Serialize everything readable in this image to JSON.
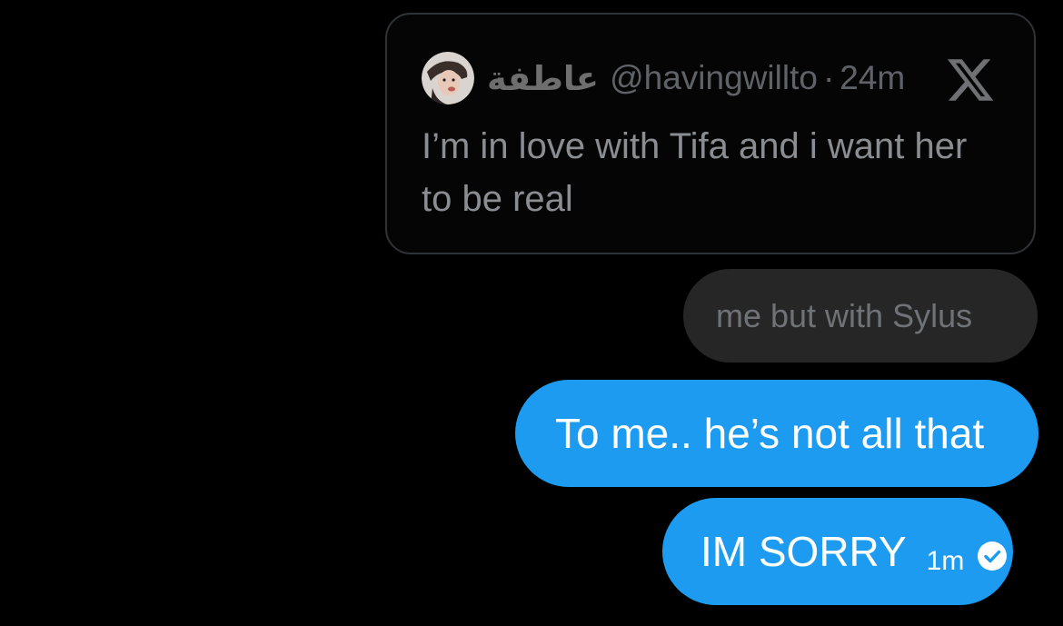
{
  "quoted_post": {
    "author_name": "عاطفة",
    "handle": "@havingwillto",
    "separator": "·",
    "time": "24m",
    "text": "I’m in love with Tifa and i want her to be real",
    "avatar_icon": "user-avatar",
    "brand_icon": "x-logo-icon"
  },
  "messages": {
    "received": {
      "text": "me but with Sylus"
    },
    "sent": [
      {
        "text": "To me.. he’s not all that"
      },
      {
        "text": "IM SORRY",
        "time": "1m",
        "status_icon": "read-check-icon"
      }
    ]
  },
  "colors": {
    "background": "#000000",
    "sent_bubble": "#1d9bf0",
    "received_bubble": "#262626",
    "card_border": "#2f3336"
  }
}
